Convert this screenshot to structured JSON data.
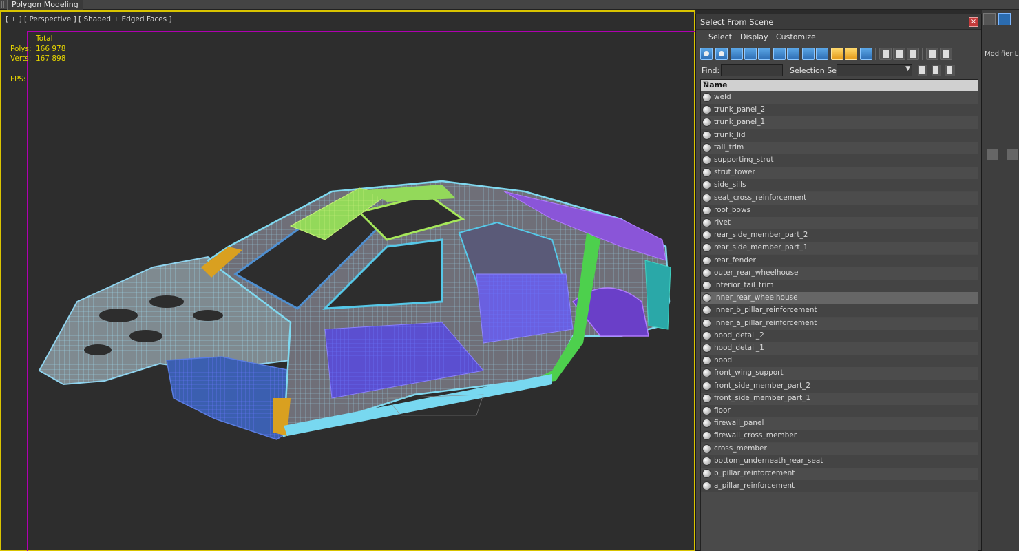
{
  "ribbon": {
    "tab_label": "Polygon Modeling"
  },
  "viewport": {
    "label": "[ + ] [ Perspective ] [ Shaded + Edged Faces ]",
    "stats": {
      "header": "Total",
      "polys_label": "Polys:",
      "polys_value": "166 978",
      "verts_label": "Verts:",
      "verts_value": "167 898",
      "fps_label": "FPS:"
    }
  },
  "dialog": {
    "title": "Select From Scene",
    "close": "×",
    "menu": {
      "select": "Select",
      "display": "Display",
      "customize": "Customize"
    },
    "find_label": "Find:",
    "find_value": "",
    "selection_set_label": "Selection Set:",
    "selection_set_arrow": "▼",
    "column_name": "Name",
    "filter_icon": "▽",
    "items": [
      "weld",
      "trunk_panel_2",
      "trunk_panel_1",
      "trunk_lid",
      "tail_trim",
      "supporting_strut",
      "strut_tower",
      "side_sills",
      "seat_cross_reinforcement",
      "roof_bows",
      "rivet",
      "rear_side_member_part_2",
      "rear_side_member_part_1",
      "rear_fender",
      "outer_rear_wheelhouse",
      "interior_tail_trim",
      "inner_rear_wheelhouse",
      "inner_b_pillar_reinforcement",
      "inner_a_pillar_reinforcement",
      "hood_detail_2",
      "hood_detail_1",
      "hood",
      "front_wing_support",
      "front_side_member_part_2",
      "front_side_member_part_1",
      "floor",
      "firewall_panel",
      "firewall_cross_member",
      "cross_member",
      "bottom_underneath_rear_seat",
      "b_pillar_reinforcement",
      "a_pillar_reinforcement"
    ],
    "selected_item": "inner_rear_wheelhouse"
  },
  "command_panel": {
    "modifier_list": "Modifier Lis"
  }
}
